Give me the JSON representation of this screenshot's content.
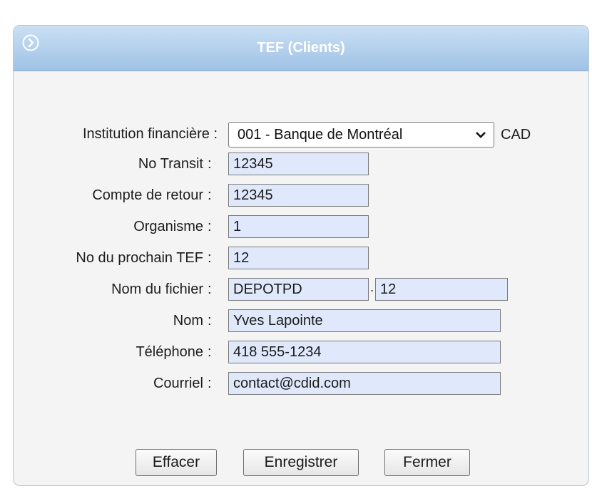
{
  "window": {
    "title": "TEF (Clients)"
  },
  "form": {
    "institution": {
      "label": "Institution financière :",
      "value": "001 - Banque de Montréal",
      "currency": "CAD"
    },
    "transit": {
      "label": "No Transit",
      "value": "12345"
    },
    "return_account": {
      "label": "Compte de retour",
      "value": "12345"
    },
    "organism": {
      "label": "Organisme",
      "value": "1"
    },
    "next_tef": {
      "label": "No du prochain TEF",
      "value": "12"
    },
    "file_name": {
      "label": "Nom du fichier",
      "value": "DEPOTPD",
      "separator": ".",
      "extension": "12"
    },
    "name": {
      "label": "Nom",
      "value": "Yves Lapointe"
    },
    "phone": {
      "label": "Téléphone",
      "value": "418 555-1234"
    },
    "email": {
      "label": "Courriel",
      "value": "contact@cdid.com"
    },
    "colon": ":"
  },
  "buttons": {
    "clear": "Effacer",
    "save": "Enregistrer",
    "close": "Fermer"
  }
}
